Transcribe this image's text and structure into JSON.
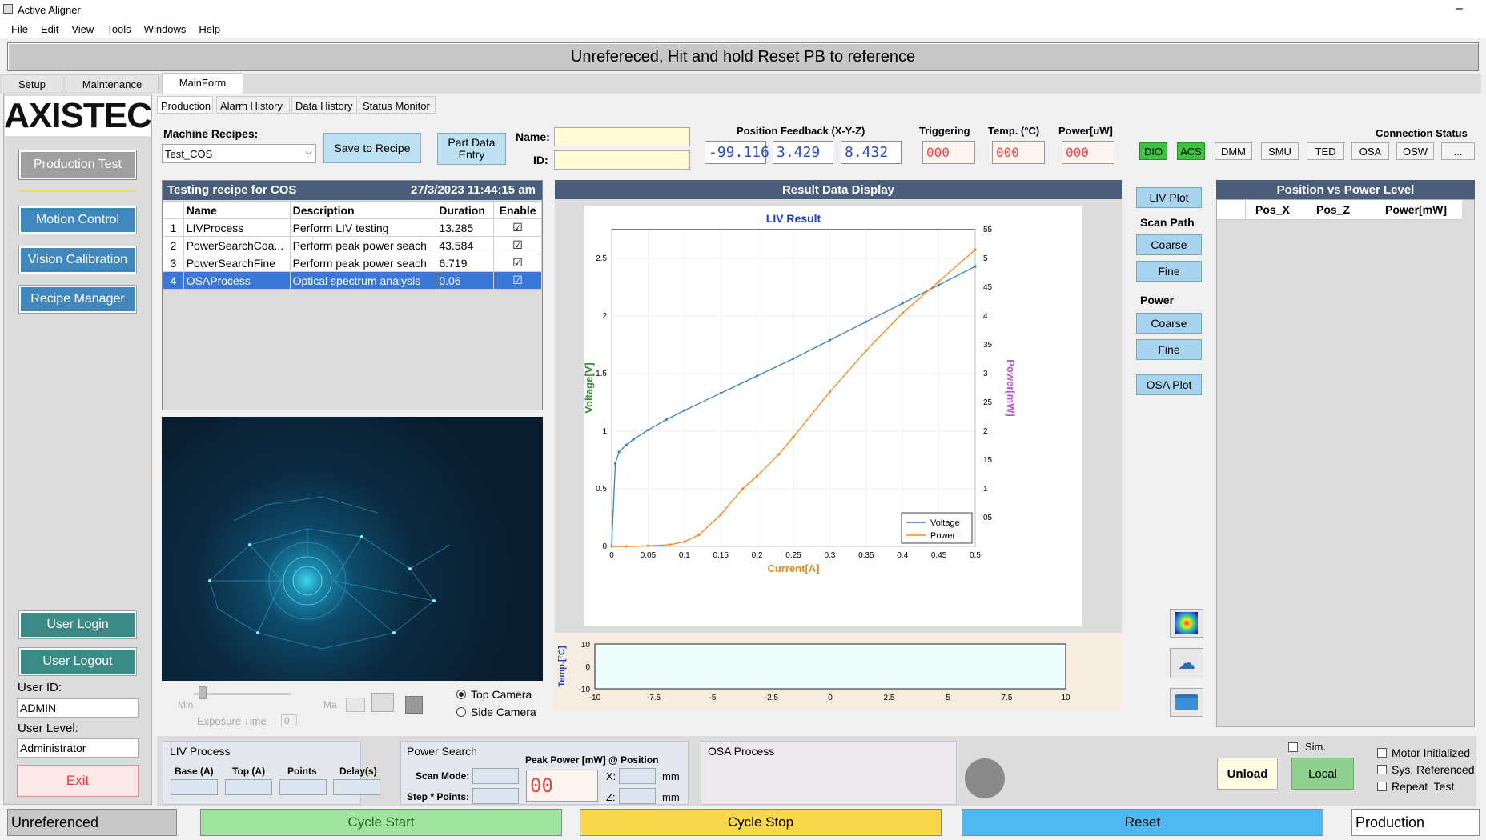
{
  "window": {
    "title": "Active Aligner",
    "close_glyph": "–"
  },
  "menu": [
    "File",
    "Edit",
    "View",
    "Tools",
    "Windows",
    "Help"
  ],
  "banner": "Unrefereced, Hit and hold Reset PB to reference",
  "top_tabs": [
    "Setup",
    "Maintenance",
    "MainForm"
  ],
  "sub_tabs": [
    "Production",
    "Alarm History",
    "Data History",
    "Status Monitor"
  ],
  "logo": "AXISTEC",
  "left_nav": {
    "production_test": "Production Test",
    "motion_control": "Motion Control",
    "vision_calibration": "Vision Calibration",
    "recipe_manager": "Recipe Manager",
    "user_login": "User Login",
    "user_logout": "User Logout",
    "user_id_label": "User ID:",
    "user_id": "ADMIN",
    "user_level_label": "User Level:",
    "user_level": "Administrator",
    "exit": "Exit"
  },
  "recipe": {
    "label": "Machine Recipes:",
    "selected": "Test_COS",
    "save": "Save to Recipe",
    "part_data_entry_1": "Part Data",
    "part_data_entry_2": "Entry",
    "name_label": "Name:",
    "id_label": "ID:"
  },
  "position_feedback": {
    "label": "Position Feedback (X-Y-Z)",
    "x": "-99.116",
    "y": "3.429",
    "z": "8.432"
  },
  "triggering": {
    "label": "Triggering",
    "value": "000"
  },
  "temp": {
    "label": "Temp. (°C)",
    "value": "000"
  },
  "power": {
    "label": "Power[uW]",
    "value": "000"
  },
  "connection": {
    "label": "Connection Status",
    "items": [
      {
        "name": "DIO",
        "on": true
      },
      {
        "name": "ACS",
        "on": true
      },
      {
        "name": "DMM",
        "on": false
      },
      {
        "name": "SMU",
        "on": false
      },
      {
        "name": "TED",
        "on": false
      },
      {
        "name": "OSA",
        "on": false
      },
      {
        "name": "OSW",
        "on": false
      },
      {
        "name": "...",
        "on": false
      }
    ]
  },
  "testing": {
    "title": "Testing recipe for COS",
    "timestamp": "27/3/2023 11:44:15 am",
    "columns": [
      "Name",
      "Description",
      "Duration",
      "Enable"
    ],
    "rows": [
      {
        "n": "1",
        "name": "LIVProcess",
        "desc": "Perform LIV testing",
        "dur": "13.285"
      },
      {
        "n": "2",
        "name": "PowerSearchCoa...",
        "desc": "Perform peak power seach",
        "dur": "43.584"
      },
      {
        "n": "3",
        "name": "PowerSearchFine",
        "desc": "Perform peak power seach",
        "dur": "6.719"
      },
      {
        "n": "4",
        "name": "OSAProcess",
        "desc": "Optical spectrum analysis",
        "dur": "0.06"
      }
    ]
  },
  "camera": {
    "min": "Min",
    "max": "Ma",
    "exposure_label": "Exposure Time",
    "exposure_value": "0",
    "top": "Top Camera",
    "side": "Side Camera"
  },
  "result_header": "Result Data Display",
  "chart_data": {
    "type": "line",
    "title": "LIV Result",
    "xlabel": "Current[A]",
    "ylabel": "Voltage[V]",
    "y2label": "Power[mW]",
    "xlim": [
      0,
      0.5
    ],
    "ylim": [
      0,
      2.75
    ],
    "y2lim": [
      0,
      5.5
    ],
    "xticks": [
      "0",
      "0.05",
      "0.1",
      "0.15",
      "0.2",
      "0.25",
      "0.3",
      "0.35",
      "0.4",
      "0.45",
      "0.5"
    ],
    "yticks": [
      "0",
      "0.5",
      "1",
      "1.5",
      "2",
      "2.5"
    ],
    "y2ticks": [
      "05",
      "1",
      "15",
      "2",
      "25",
      "3",
      "35",
      "4",
      "45",
      "5",
      "55"
    ],
    "legend_position": "bottom-right",
    "series": [
      {
        "name": "Voltage",
        "axis": "left",
        "color": "#3c7fc0",
        "x": [
          0,
          0.005,
          0.01,
          0.02,
          0.03,
          0.05,
          0.075,
          0.1,
          0.15,
          0.2,
          0.25,
          0.3,
          0.35,
          0.4,
          0.45,
          0.5
        ],
        "y": [
          0,
          0.72,
          0.82,
          0.88,
          0.93,
          1.01,
          1.1,
          1.18,
          1.33,
          1.48,
          1.63,
          1.79,
          1.95,
          2.11,
          2.27,
          2.43
        ]
      },
      {
        "name": "Power",
        "axis": "right",
        "color": "#f08a1e",
        "x": [
          0,
          0.02,
          0.05,
          0.08,
          0.1,
          0.12,
          0.15,
          0.18,
          0.2,
          0.23,
          0.25,
          0.3,
          0.35,
          0.4,
          0.45,
          0.5
        ],
        "y": [
          0,
          0.0,
          0.01,
          0.03,
          0.08,
          0.2,
          0.55,
          1.0,
          1.22,
          1.6,
          1.9,
          2.68,
          3.4,
          4.05,
          4.6,
          5.15
        ]
      }
    ]
  },
  "temp_chart": {
    "ylabel": "Temp.[°C]",
    "yticks": [
      "10",
      "0",
      "-10"
    ],
    "xticks": [
      "-10",
      "-7.5",
      "-5",
      "-2.5",
      "0",
      "2.5",
      "5",
      "7.5",
      "10"
    ]
  },
  "side_buttons": {
    "liv_plot": "LIV Plot",
    "scan_path": "Scan Path",
    "coarse": "Coarse",
    "fine": "Fine",
    "power": "Power",
    "power_coarse": "Coarse",
    "power_fine": "Fine",
    "osa_plot": "OSA Plot"
  },
  "pos_vs_power": {
    "title": "Position vs Power Level",
    "columns": [
      "Pos_X",
      "Pos_Z",
      "Power[mW]"
    ]
  },
  "liv_group": {
    "title": "LIV Process",
    "base": "Base (A)",
    "top": "Top (A)",
    "points": "Points",
    "delay": "Delay(s)"
  },
  "power_search": {
    "title": "Power Search",
    "scan_mode": "Scan Mode:",
    "step_points": "Step * Points:",
    "peak": "Peak Power [mW] @ Position",
    "peak_value": "00",
    "x": "X:",
    "z": "Z:",
    "mm": "mm"
  },
  "osa_group": {
    "title": "OSA Process"
  },
  "controls": {
    "sim": "Sim.",
    "unload": "Unload",
    "local": "Local",
    "motor_init": "Motor Initialized",
    "sys_ref": "Sys. Referenced",
    "repeat": "Repeat  Test"
  },
  "status_bar": {
    "status": "Unreferenced",
    "cycle_start": "Cycle Start",
    "cycle_stop": "Cycle Stop",
    "reset": "Reset",
    "mode": "Production"
  }
}
